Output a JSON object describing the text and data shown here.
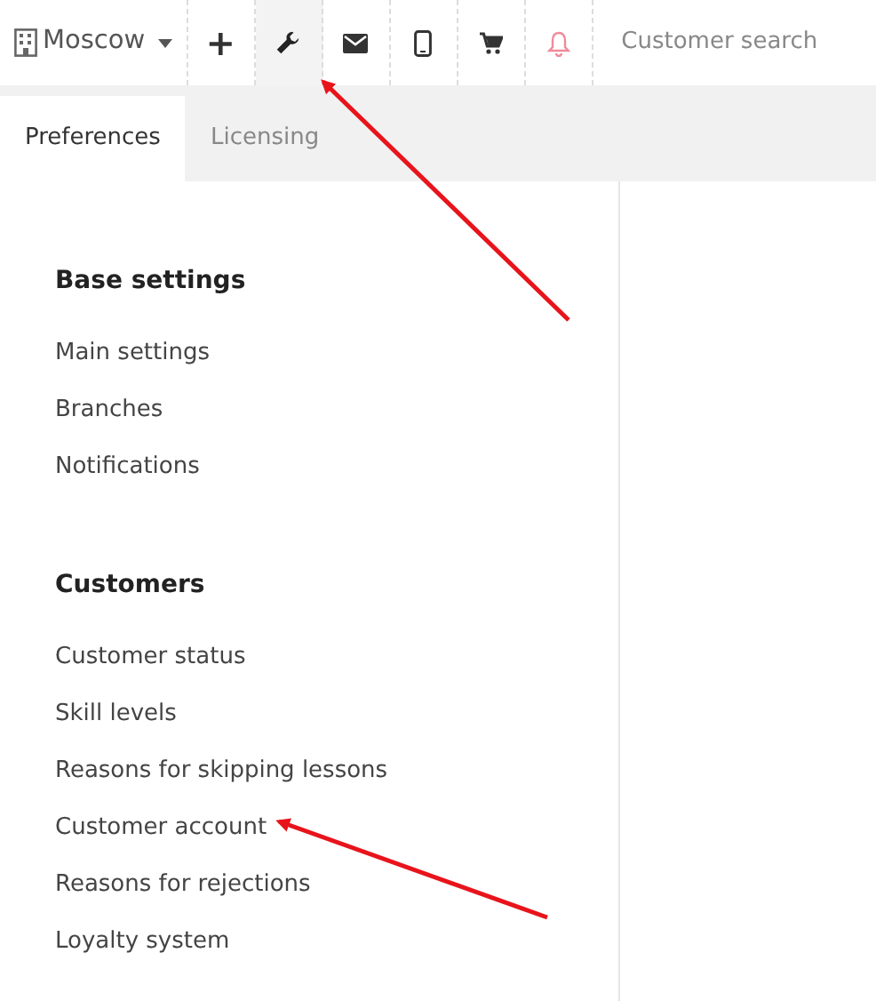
{
  "toolbar": {
    "branch": {
      "label": "Moscow"
    },
    "buttons": [
      {
        "kind": "add",
        "label": "+",
        "selected": false
      },
      {
        "kind": "wrench",
        "selected": true
      },
      {
        "kind": "mail",
        "selected": false
      },
      {
        "kind": "phone",
        "selected": false
      },
      {
        "kind": "cart",
        "selected": false
      },
      {
        "kind": "bell",
        "selected": false
      }
    ],
    "search": {
      "placeholder": "Customer search"
    }
  },
  "tabs": [
    {
      "label": "Preferences",
      "selected": true
    },
    {
      "label": "Licensing",
      "selected": false
    }
  ],
  "sections": [
    {
      "title": "Base settings",
      "items": [
        "Main settings",
        "Branches",
        "Notifications"
      ]
    },
    {
      "title": "Customers",
      "items": [
        "Customer status",
        "Skill levels",
        "Reasons for skipping lessons",
        "Customer account",
        "Reasons for rejections",
        "Loyalty system"
      ]
    }
  ]
}
